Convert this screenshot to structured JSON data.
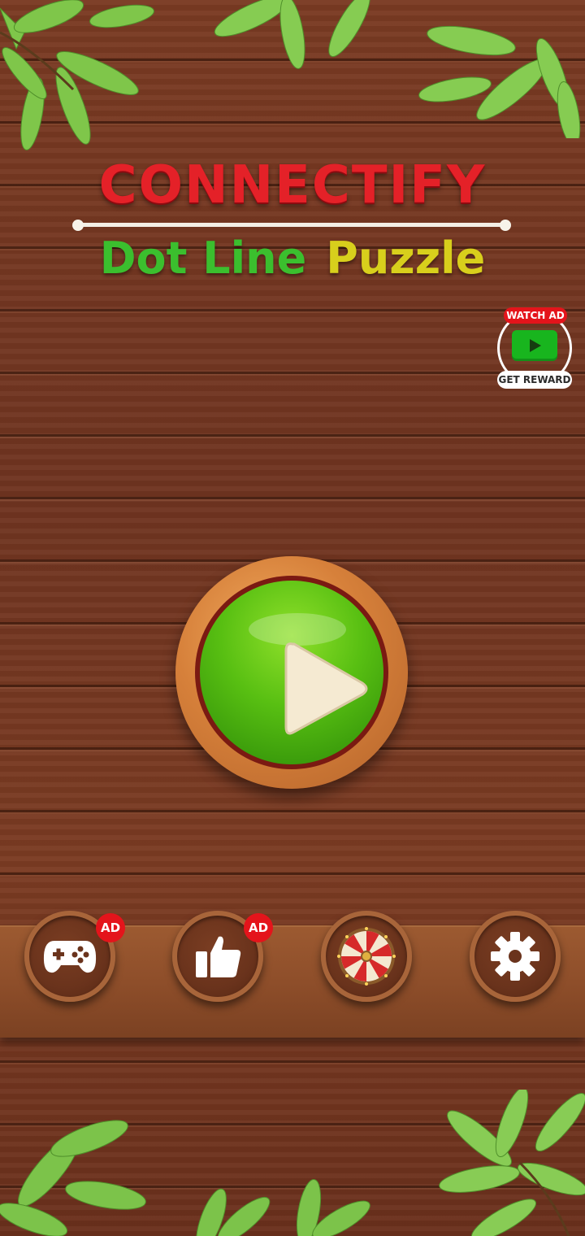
{
  "title": {
    "main": "CONNECTIFY",
    "subtitle_part1": "Dot Line",
    "subtitle_part2": "Puzzle"
  },
  "reward_ad": {
    "top_label": "WATCH AD",
    "bottom_label": "GET REWARD",
    "icon": "video-play-icon"
  },
  "play_button": {
    "icon": "play-icon"
  },
  "bottom_menu": [
    {
      "name": "more-games-button",
      "icon": "gamepad-icon",
      "badge": "AD"
    },
    {
      "name": "rate-button",
      "icon": "thumbs-up-icon",
      "badge": "AD"
    },
    {
      "name": "lucky-spin-button",
      "icon": "prize-wheel-icon",
      "badge": ""
    },
    {
      "name": "settings-button",
      "icon": "gear-icon",
      "badge": ""
    }
  ],
  "colors": {
    "title_red": "#e42128",
    "subtitle_green": "#3bbf2e",
    "subtitle_yellow": "#d8cf1c",
    "play_green": "#58bf12",
    "badge_red": "#e4141b",
    "wood": "#7a3a22"
  }
}
